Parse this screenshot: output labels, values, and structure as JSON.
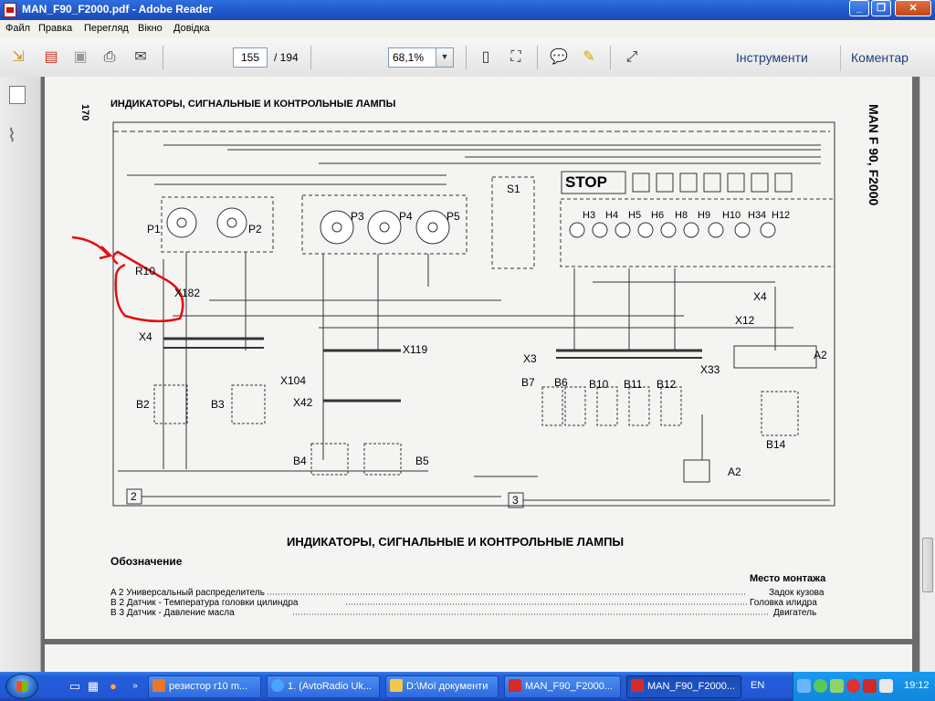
{
  "window": {
    "title": "MAN_F90_F2000.pdf - Adobe Reader"
  },
  "menu": [
    "Файл",
    "Правка",
    "Перегляд",
    "Вікно",
    "Довідка"
  ],
  "toolbar": {
    "page_current": "155",
    "page_total": "/ 194",
    "zoom": "68,1%",
    "tools_label": "Інструменти",
    "comment_label": "Коментар"
  },
  "document": {
    "page_number_label": "170",
    "heading": "ИНДИКАТОРЫ, СИГНАЛЬНЫЕ И КОНТРОЛЬНЫЕ ЛАМПЫ",
    "side_title": "MAN F 90, F2000",
    "caption": "ИНДИКАТОРЫ, СИГНАЛЬНЫЕ И КОНТРОЛЬНЫЕ ЛАМПЫ",
    "designation_heading": "Обозначение",
    "location_heading": "Место монтажа",
    "legend": [
      {
        "code": "A 2",
        "text": "Универсальный распределитель",
        "location": "Задок кузова"
      },
      {
        "code": "B 2",
        "text": "Датчик - Температура головки цилиндра",
        "location": "Головка илидра"
      },
      {
        "code": "B 3",
        "text": "Датчик - Давление масла",
        "location": "Двигатель"
      }
    ],
    "components": {
      "R10": "R10",
      "X182": "X182",
      "P1": "P1",
      "P2": "P2",
      "P3": "P3",
      "P4": "P4",
      "P5": "P5",
      "S1": "S1",
      "STOP": "STOP",
      "H3": "H3",
      "H4": "H4",
      "H5": "H5",
      "H6": "H6",
      "H8": "H8",
      "H9": "H9",
      "H10": "H10",
      "H34": "H34",
      "H12": "H12",
      "X4a": "X4",
      "X4b": "X4",
      "X12": "X12",
      "A2a": "A2",
      "A2b": "A2",
      "X104": "X104",
      "X119": "X119",
      "X42": "X42",
      "X3": "X3",
      "X33": "X33",
      "B2": "B2",
      "B3": "B3",
      "B4": "B4",
      "B5": "B5",
      "B7": "B7",
      "B6": "B6",
      "B10": "B10",
      "B11": "B11",
      "B12": "B12",
      "B14": "B14",
      "box2": "2",
      "box3": "3"
    }
  },
  "taskbar": {
    "tasks": [
      {
        "label": "резистор r10 m...",
        "color": "#e8762c"
      },
      {
        "label": "1. (AvtoRadio Uk...",
        "color": "#4aa3ff"
      },
      {
        "label": "D:\\Мої документи",
        "color": "#f2c84b"
      },
      {
        "label": "MAN_F90_F2000...",
        "color": "#d42b2b"
      },
      {
        "label": "MAN_F90_F2000...",
        "color": "#d42b2b"
      }
    ],
    "language": "EN",
    "clock": "19:12"
  }
}
